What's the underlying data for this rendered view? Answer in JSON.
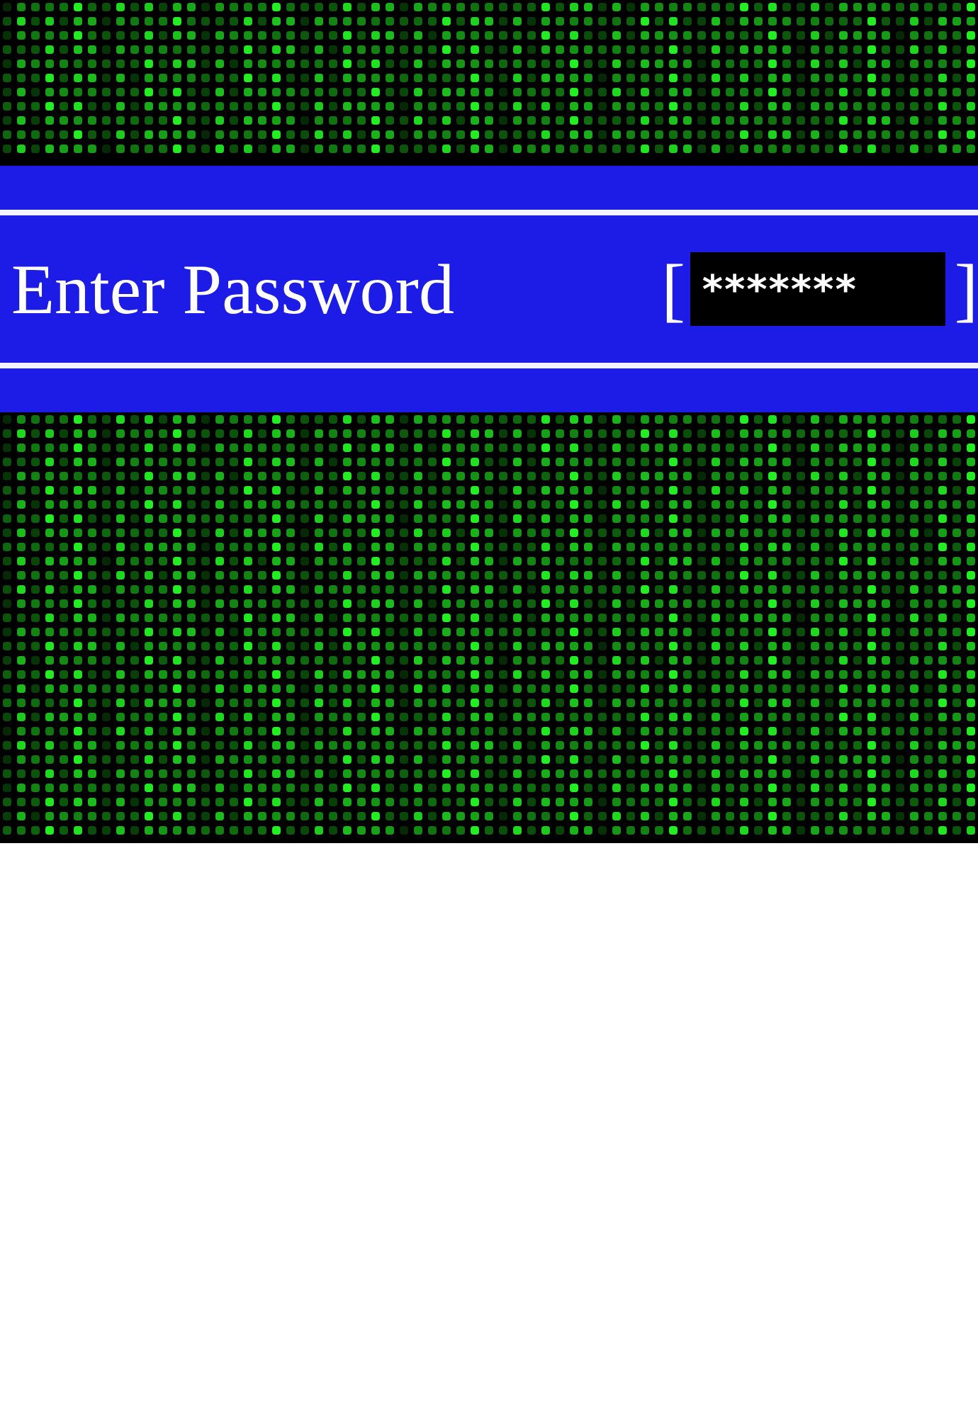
{
  "prompt": {
    "label": "Enter Password",
    "bracket_open": "[",
    "value": "*******",
    "bracket_close": "]"
  }
}
